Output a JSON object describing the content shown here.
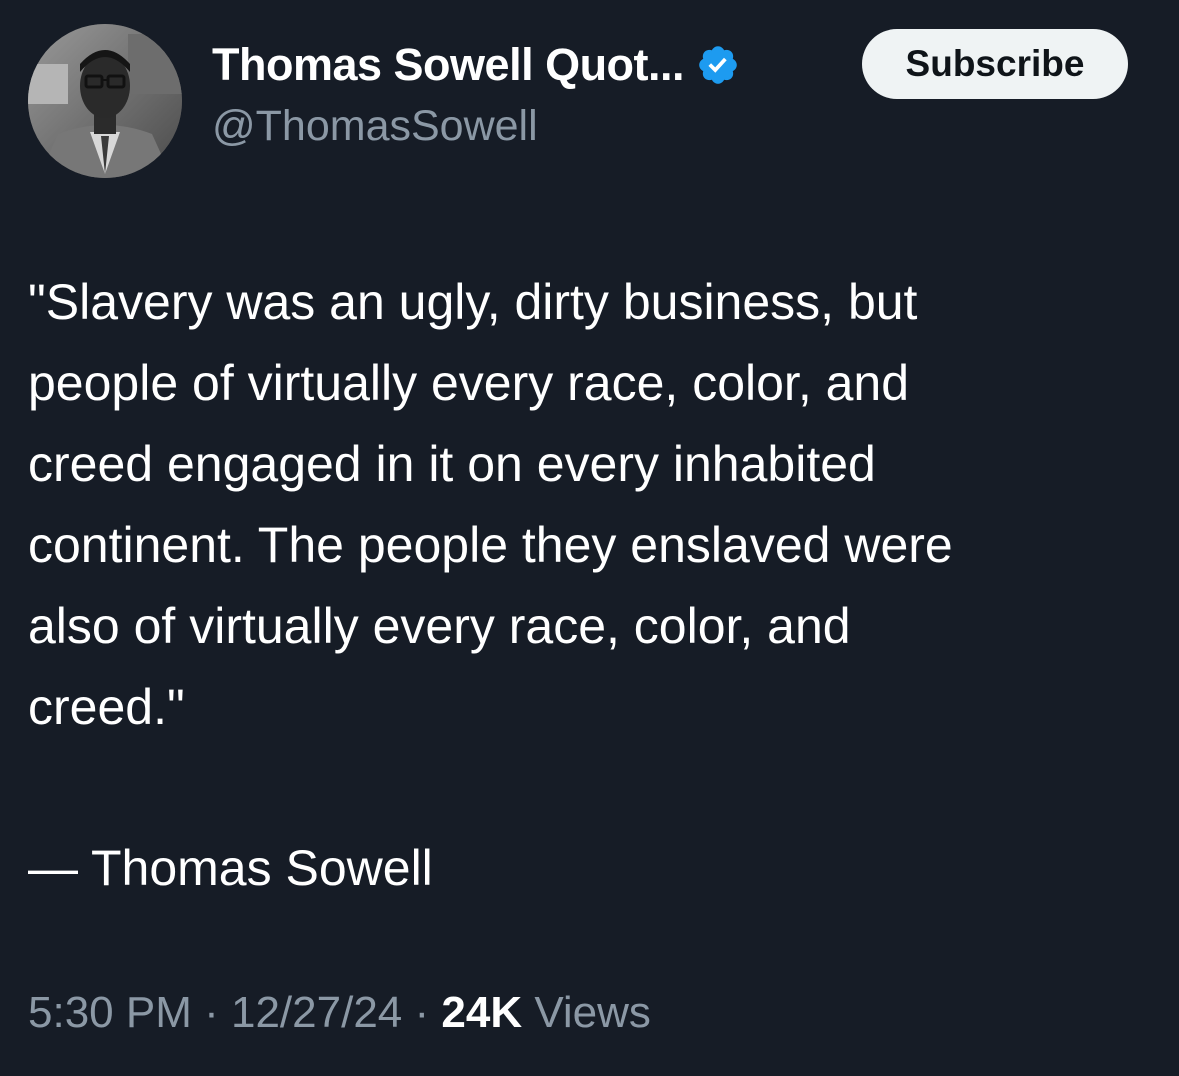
{
  "author": {
    "display_name": "Thomas Sowell Quot...",
    "handle": "@ThomasSowell",
    "verified_icon": "verified-badge-icon",
    "avatar_description": "avatar"
  },
  "actions": {
    "subscribe_label": "Subscribe"
  },
  "tweet": {
    "text": "\"Slavery was an ugly, dirty business, but\npeople of virtually every race, color, and\ncreed engaged in it on every inhabited\ncontinent. The people they enslaved were\nalso of virtually every race, color, and\ncreed.\"",
    "attribution": "— Thomas Sowell"
  },
  "meta": {
    "time": "5:30 PM",
    "separator": " · ",
    "date": "12/27/24",
    "views_count": "24K",
    "views_label": " Views"
  },
  "colors": {
    "background": "#161c26",
    "verified": "#1d9bf0",
    "muted_text": "#8b98a5",
    "subscribe_bg": "#eff3f4"
  }
}
